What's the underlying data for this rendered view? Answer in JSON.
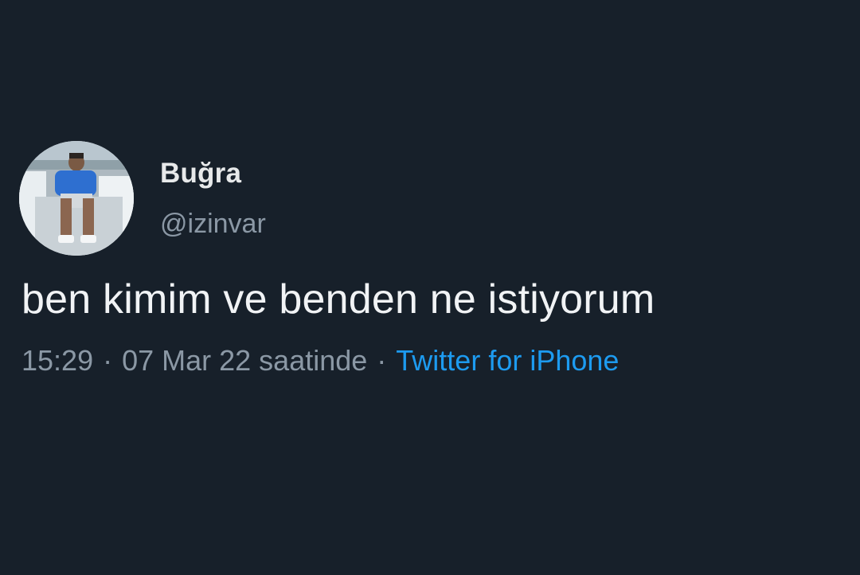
{
  "tweet": {
    "display_name": "Buğra",
    "handle": "@izinvar",
    "text": "ben kimim ve benden ne istiyorum",
    "time": "15:29",
    "date_text": "07 Mar 22 saatinde",
    "separator": "·",
    "source": "Twitter for iPhone"
  },
  "colors": {
    "background": "#17202a",
    "text_primary": "#e7e9ea",
    "text_secondary": "#8b98a5",
    "link": "#1d9bf0"
  }
}
